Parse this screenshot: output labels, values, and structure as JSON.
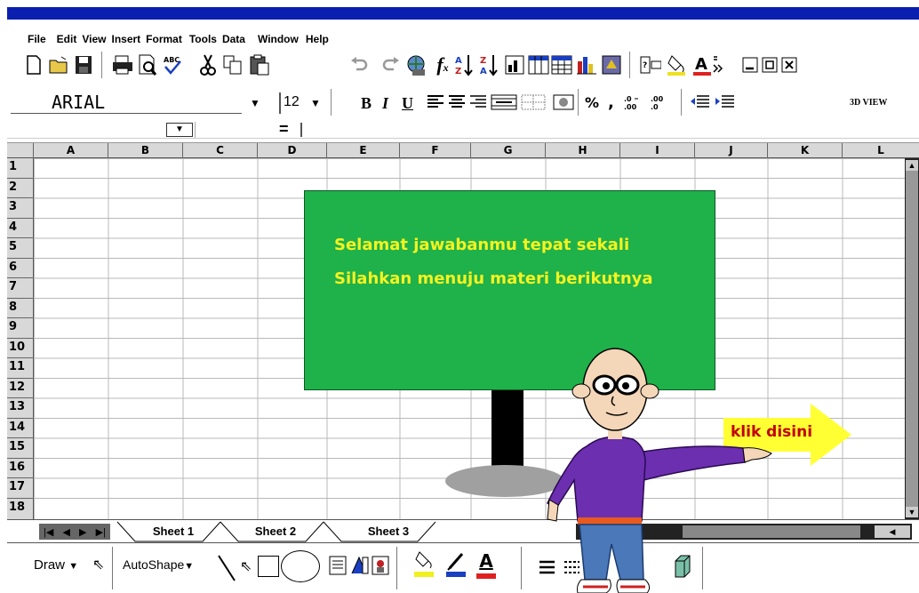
{
  "menu": [
    "File",
    "Edit",
    "View",
    "Insert",
    "Format",
    "Tools",
    "Data",
    "Window",
    "Help"
  ],
  "toolbar": {
    "font_name": "ARIAL",
    "font_size": "12",
    "bold": "B",
    "italic": "I",
    "underline": "U",
    "percent": "%",
    "comma": ",",
    "view_3d": "3D VIEW"
  },
  "formula": {
    "equals": "="
  },
  "columns": [
    "A",
    "B",
    "C",
    "D",
    "E",
    "F",
    "G",
    "H",
    "I",
    "J",
    "K",
    "L"
  ],
  "rows": [
    "1",
    "2",
    "3",
    "4",
    "5",
    "6",
    "7",
    "8",
    "9",
    "10",
    "11",
    "12",
    "13",
    "14",
    "15",
    "16",
    "17",
    "18"
  ],
  "sheets": [
    "Sheet 1",
    "Sheet 2",
    "Sheet 3"
  ],
  "board": {
    "line1": "Selamat jawabanmu tepat sekali",
    "line2": "Silahkan menuju materi berikutnya"
  },
  "next_button": "klik disini",
  "drawing": {
    "draw": "Draw",
    "autoshape": "AutoShape",
    "font_color_letter": "A"
  },
  "colors": {
    "title_blue": "#0a1fb0",
    "board_green": "#1fb14a",
    "board_text": "#f3f321",
    "arrow_yellow": "#ffff33",
    "arrow_text": "#c00000"
  }
}
